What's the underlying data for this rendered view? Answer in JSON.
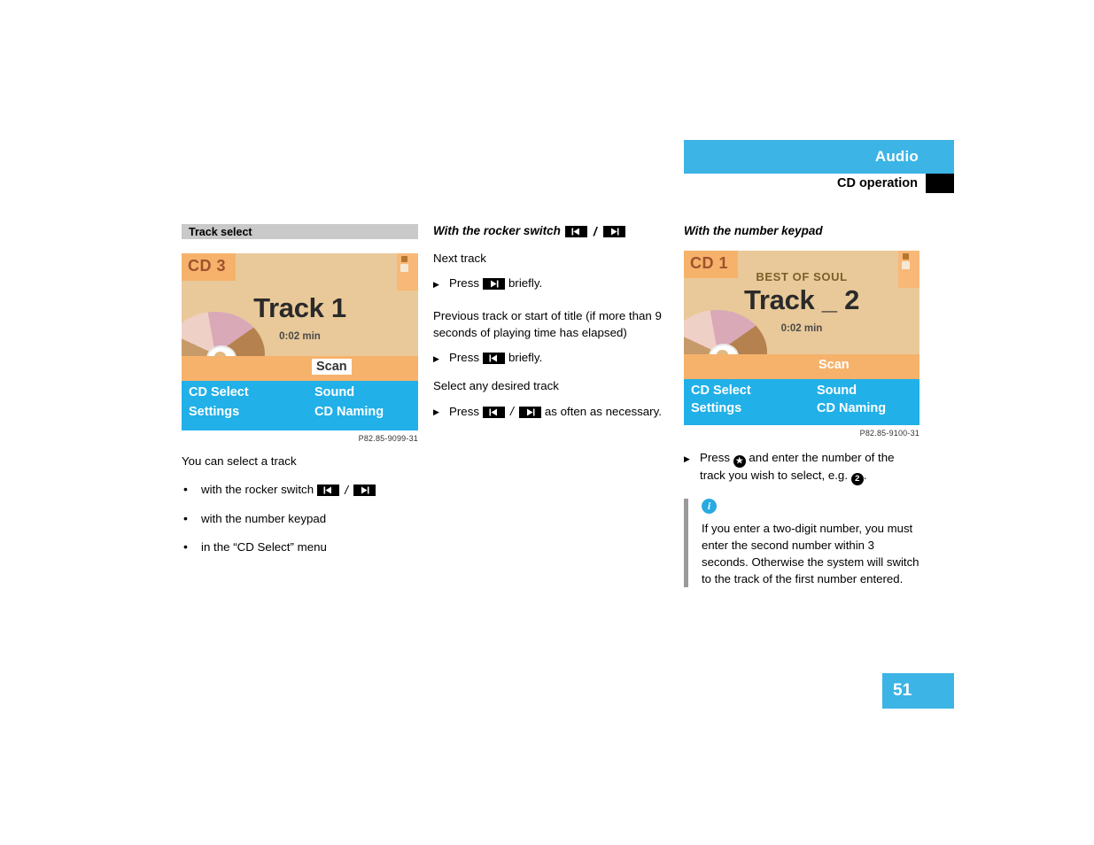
{
  "header": {
    "title": "Audio",
    "subtitle": "CD operation"
  },
  "page_number": "51",
  "left_column": {
    "section_title": "Track select",
    "screen": {
      "cd_label": "CD 3",
      "album": "",
      "track_title": "Track 1",
      "track_time": "0:02 min",
      "scan_label": "Scan",
      "scan_selected": true,
      "menu": {
        "item1": "CD Select",
        "item2": "Settings",
        "item3": "Sound",
        "item4": "CD Naming"
      }
    },
    "figure_caption": "P82.85-9099-31",
    "intro": "You can select a track",
    "bullets": [
      {
        "prefix": "with the rocker switch",
        "icons": [
          "skip-back",
          "skip-forward"
        ]
      },
      {
        "prefix": "with the number keypad",
        "icons": []
      },
      {
        "prefix": "in the “CD Select” menu",
        "icons": []
      }
    ]
  },
  "middle_column": {
    "subhead": "With the rocker switch",
    "subhead_icons": [
      "skip-back",
      "skip-forward"
    ],
    "next_track_label": "Next track",
    "next_track_step": {
      "press": "Press",
      "icon": "skip-forward",
      "suffix": "briefly."
    },
    "previous_track_label": "Previous track or start of title (if more than 9 seconds of playing time has elapsed)",
    "previous_track_step": {
      "press": "Press",
      "icon": "skip-back",
      "suffix": "briefly."
    },
    "select_any_label": "Select any desired track",
    "select_any_step": {
      "press": "Press",
      "icons": [
        "skip-back",
        "skip-forward"
      ],
      "suffix": "as often as necessary."
    }
  },
  "right_column": {
    "subhead": "With the number keypad",
    "screen": {
      "cd_label": "CD 1",
      "album": "BEST OF SOUL",
      "track_title": "Track _ 2",
      "track_time": "0:02 min",
      "scan_label": "Scan",
      "scan_selected": false,
      "menu": {
        "item1": "CD Select",
        "item2": "Settings",
        "item3": "Sound",
        "item4": "CD Naming"
      }
    },
    "figure_caption": "P82.85-9100-31",
    "step": {
      "press": "Press",
      "star_key": "★",
      "middle": "and enter the number of the track you wish to select, e.g.",
      "number_key": "2",
      "end": "."
    },
    "note": {
      "icon": "info-icon",
      "text": "If you enter a two-digit number, you must enter the second number within 3 seconds. Otherwise the system will switch to the track of the first number entered."
    }
  },
  "colors": {
    "accent_blue": "#3cb4e5",
    "screen_blue": "#21b0e8",
    "screen_tan": "#e9c999",
    "screen_orange": "#f6b26b",
    "section_gray": "#c9c9c9"
  }
}
